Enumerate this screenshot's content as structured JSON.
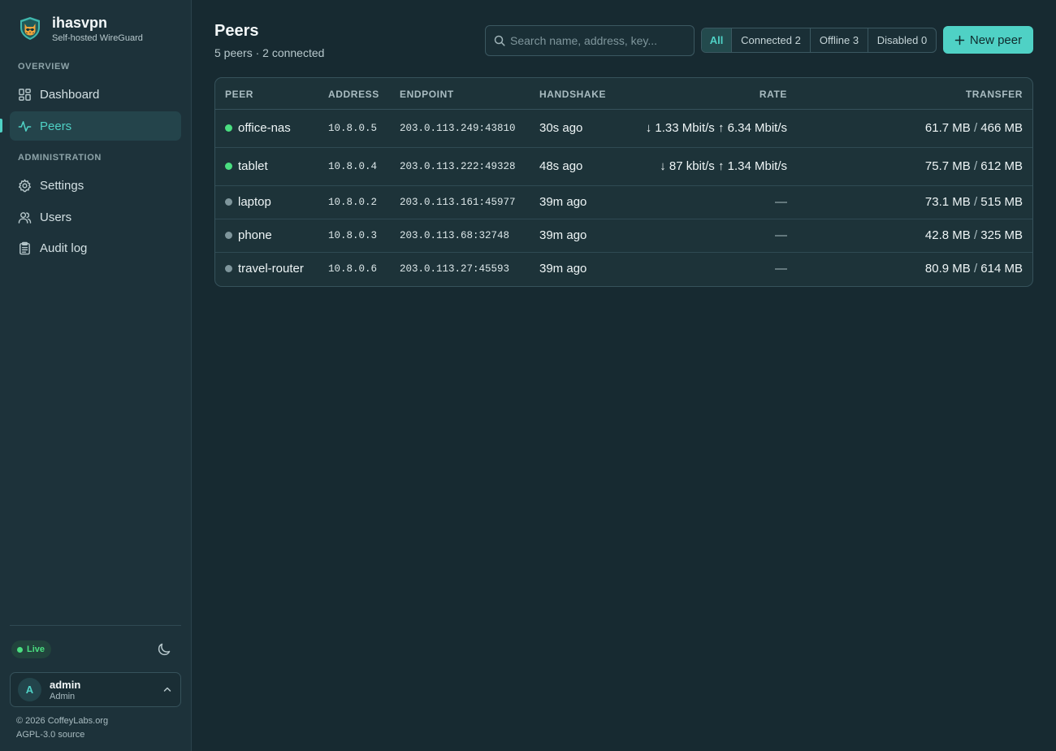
{
  "brand": {
    "name": "ihasvpn",
    "subtitle": "Self-hosted WireGuard"
  },
  "sidebar": {
    "sections": [
      {
        "label": "OVERVIEW"
      },
      {
        "label": "ADMINISTRATION"
      }
    ],
    "items": [
      {
        "label": "Dashboard",
        "icon": "dashboard-icon"
      },
      {
        "label": "Peers",
        "icon": "activity-icon",
        "active": true
      },
      {
        "label": "Settings",
        "icon": "gear-icon"
      },
      {
        "label": "Users",
        "icon": "users-icon"
      },
      {
        "label": "Audit log",
        "icon": "clipboard-icon"
      }
    ],
    "live_label": "Live",
    "user": {
      "initial": "A",
      "name": "admin",
      "role": "Admin"
    },
    "footer": {
      "copyright": "© 2026 CoffeyLabs.org",
      "source": "AGPL-3.0 source"
    }
  },
  "header": {
    "title": "Peers",
    "subtitle": "5 peers · 2 connected",
    "search_placeholder": "Search name, address, key...",
    "filters": [
      {
        "label": "All",
        "active": true
      },
      {
        "label": "Connected 2"
      },
      {
        "label": "Offline 3"
      },
      {
        "label": "Disabled 0"
      }
    ],
    "new_peer_label": "New peer"
  },
  "table": {
    "columns": {
      "peer": "PEER",
      "address": "ADDRESS",
      "endpoint": "ENDPOINT",
      "handshake": "HANDSHAKE",
      "rate": "RATE",
      "transfer": "TRANSFER"
    },
    "rows": [
      {
        "name": "office-nas",
        "connected": true,
        "address": "10.8.0.5",
        "endpoint": "203.0.113.249:43810",
        "handshake": "30s ago",
        "rate": "↓ 1.33 Mbit/s ↑ 6.34 Mbit/s",
        "rx": "61.7 MB",
        "sep": "/",
        "tx": "466 MB"
      },
      {
        "name": "tablet",
        "connected": true,
        "address": "10.8.0.4",
        "endpoint": "203.0.113.222:49328",
        "handshake": "48s ago",
        "rate": "↓ 87 kbit/s ↑ 1.34 Mbit/s",
        "rx": "75.7 MB",
        "sep": "/",
        "tx": "612 MB"
      },
      {
        "name": "laptop",
        "connected": false,
        "address": "10.8.0.2",
        "endpoint": "203.0.113.161:45977",
        "handshake": "39m ago",
        "rate": "—",
        "rx": "73.1 MB",
        "sep": "/",
        "tx": "515 MB"
      },
      {
        "name": "phone",
        "connected": false,
        "address": "10.8.0.3",
        "endpoint": "203.0.113.68:32748",
        "handshake": "39m ago",
        "rate": "—",
        "rx": "42.8 MB",
        "sep": "/",
        "tx": "325 MB"
      },
      {
        "name": "travel-router",
        "connected": false,
        "address": "10.8.0.6",
        "endpoint": "203.0.113.27:45593",
        "handshake": "39m ago",
        "rate": "—",
        "rx": "80.9 MB",
        "sep": "/",
        "tx": "614 MB"
      }
    ]
  },
  "colors": {
    "accent": "#4fd1c5",
    "online": "#4ade80",
    "offline": "#7f969c",
    "background": "#172a31",
    "sidebar": "#1d323a"
  }
}
